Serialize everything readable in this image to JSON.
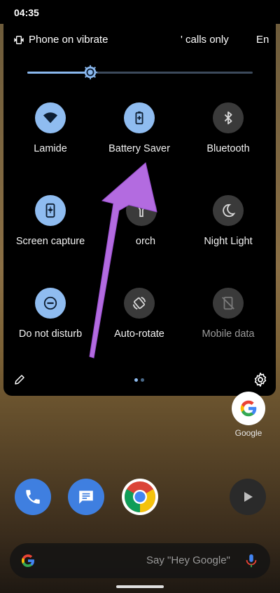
{
  "status_bar": {
    "time": "04:35"
  },
  "header": {
    "vibrate_label": "Phone on vibrate",
    "calls_label": "' calls only",
    "truncated_label": "En"
  },
  "brightness": {
    "level": 0.28
  },
  "tiles": [
    {
      "label": "Lamide",
      "icon": "wifi-icon",
      "state": "on"
    },
    {
      "label": "Battery Saver",
      "icon": "battery-saver-icon",
      "state": "on"
    },
    {
      "label": "Bluetooth",
      "icon": "bluetooth-icon",
      "state": "off"
    },
    {
      "label": "Screen capture",
      "icon": "screen-capture-icon",
      "state": "on"
    },
    {
      "label": "orch",
      "icon": "flashlight-icon",
      "state": "off"
    },
    {
      "label": "Night Light",
      "icon": "moon-icon",
      "state": "off"
    },
    {
      "label": "Do not disturb",
      "icon": "do-not-disturb-icon",
      "state": "on"
    },
    {
      "label": "Auto-rotate",
      "icon": "auto-rotate-icon",
      "state": "off"
    },
    {
      "label": "Mobile data",
      "icon": "mobile-data-off-icon",
      "state": "disabled"
    }
  ],
  "footer": {
    "page_count": 2,
    "current_page": 0
  },
  "home": {
    "google_app_label": "Google",
    "search_hint": "Say \"Hey Google\""
  },
  "colors": {
    "accent": "#8fbcf0",
    "tile_off": "#3a3a3a",
    "arrow": "#b36be0",
    "panel": "#000000"
  }
}
